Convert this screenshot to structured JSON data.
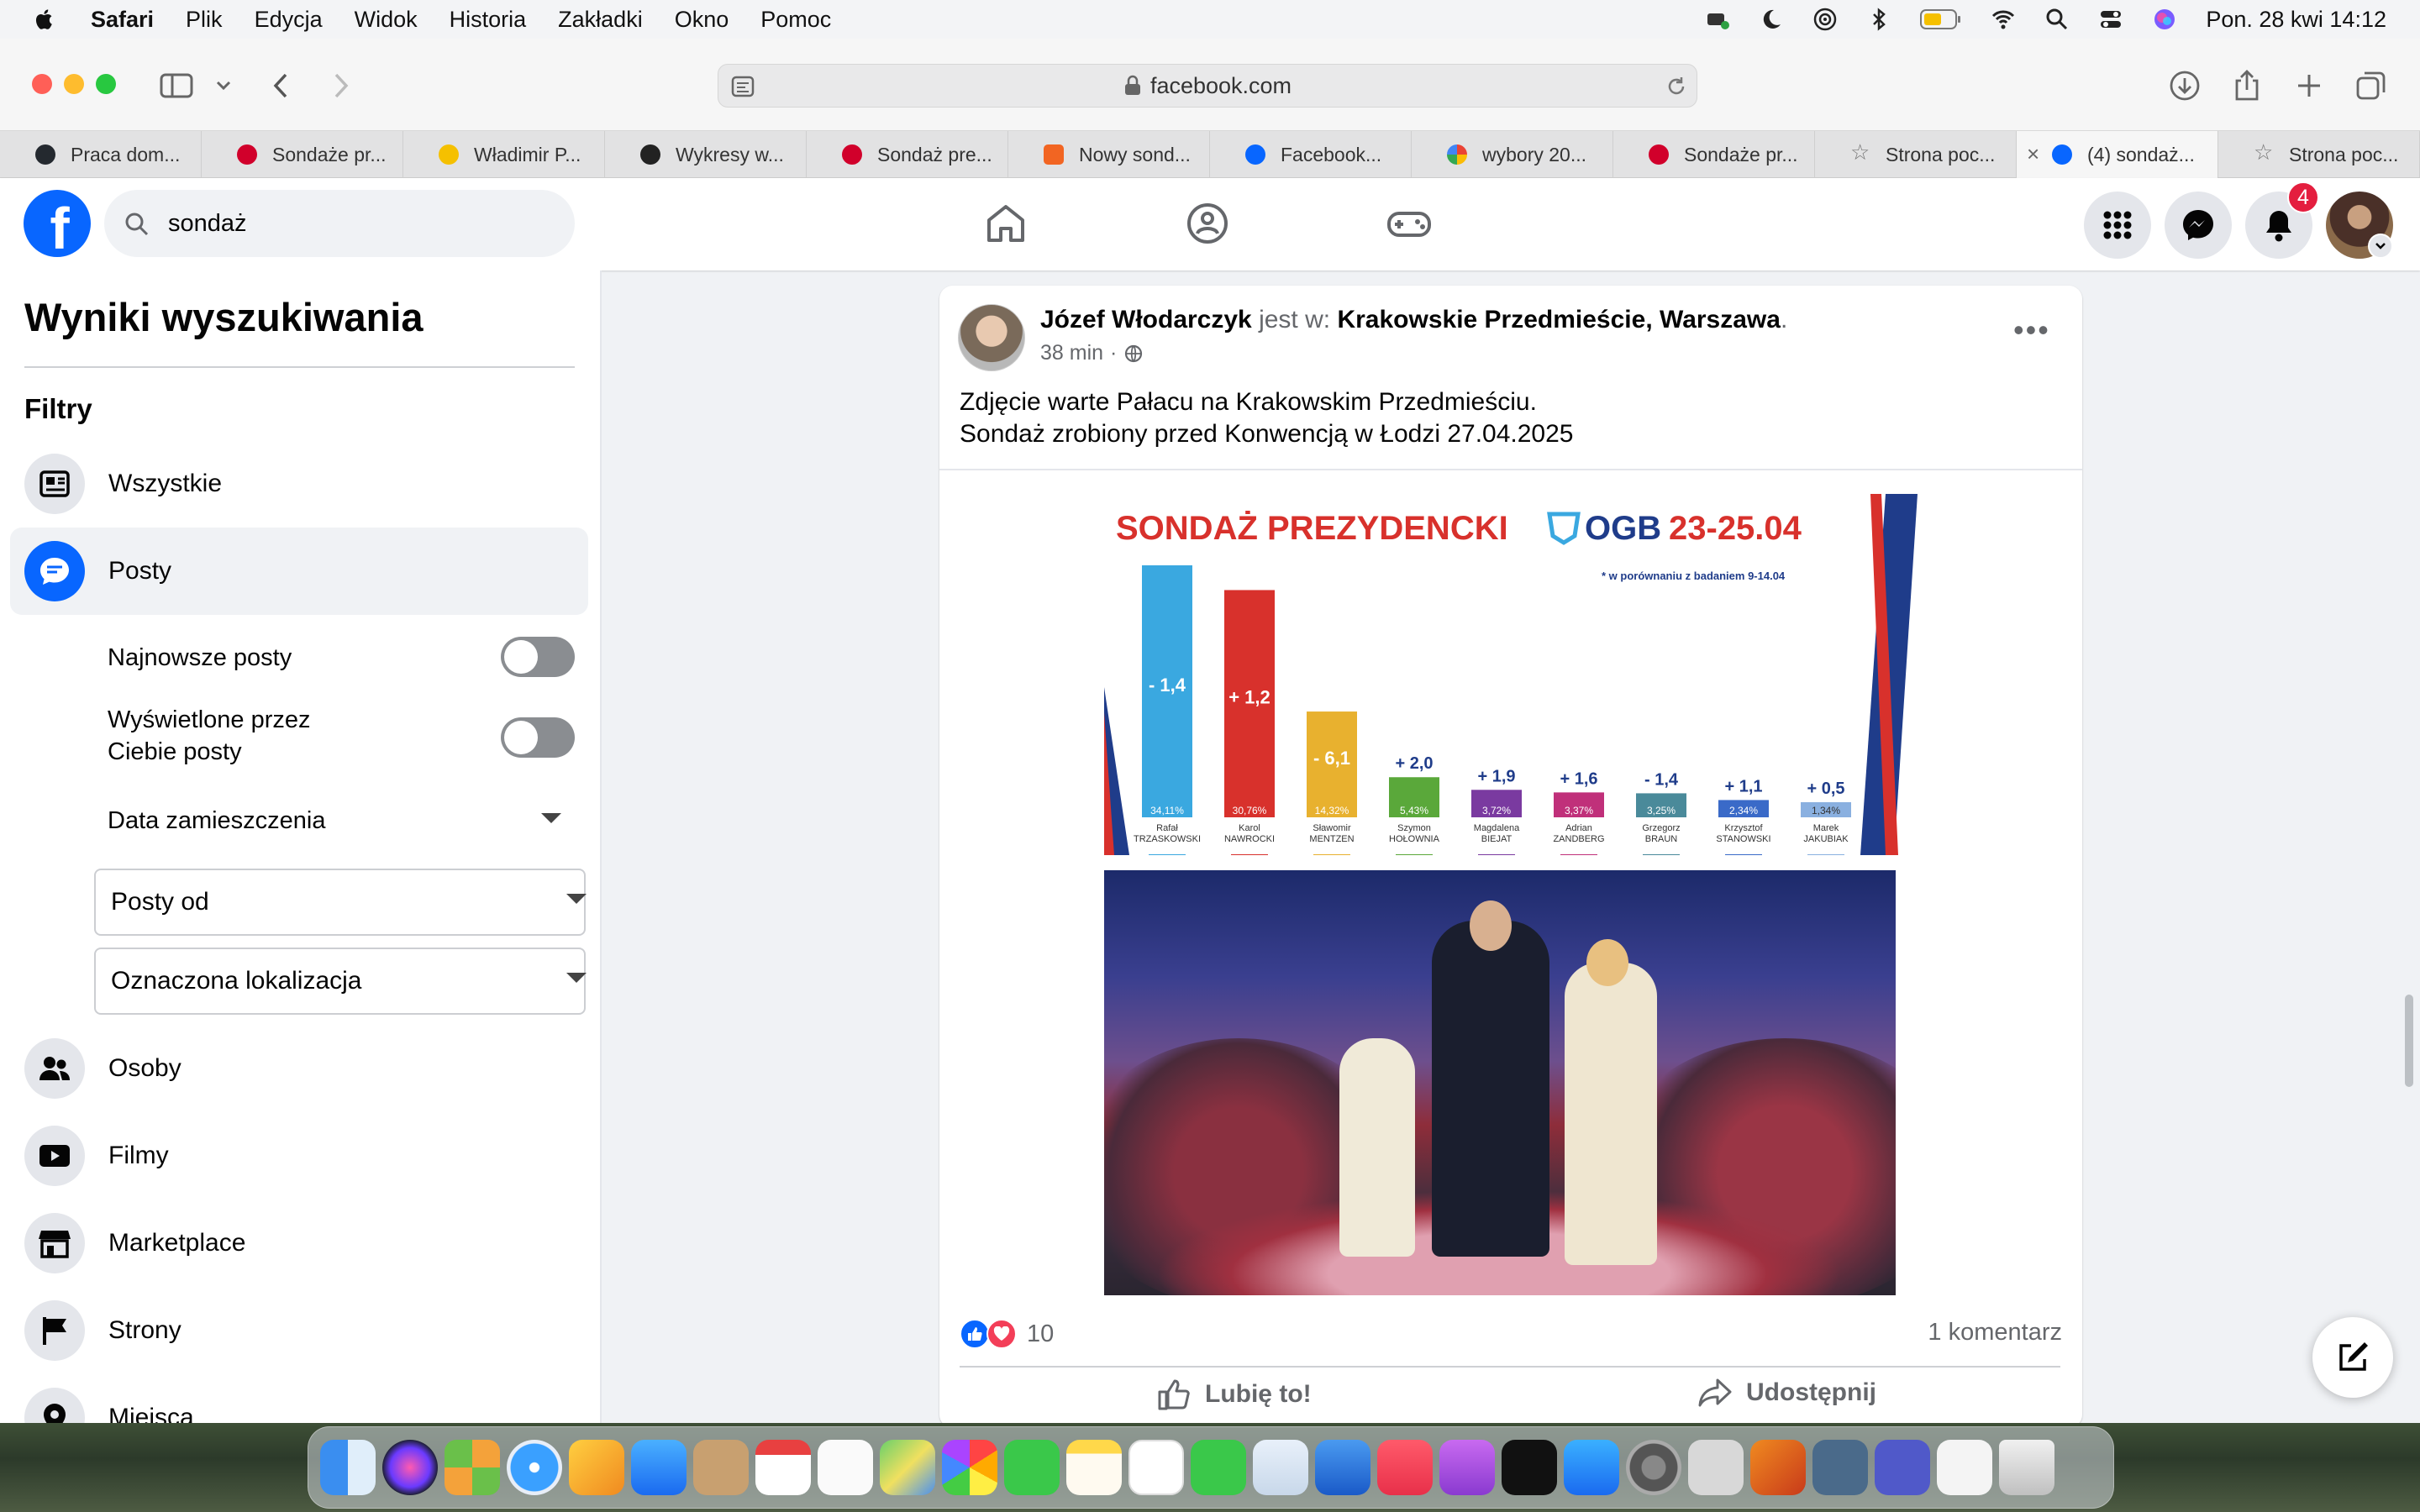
{
  "menubar": {
    "app": "Safari",
    "items": [
      "Plik",
      "Edycja",
      "Widok",
      "Historia",
      "Zakładki",
      "Okno",
      "Pomoc"
    ],
    "datetime": "Pon. 28 kwi  14:12"
  },
  "browser": {
    "url": "facebook.com",
    "tabs": [
      {
        "label": "Praca dom...",
        "color": "#24292f"
      },
      {
        "label": "Sondaże pr...",
        "color": "#d1002b"
      },
      {
        "label": "Władimir P...",
        "color": "#f5c000"
      },
      {
        "label": "Wykresy w...",
        "color": "#222222"
      },
      {
        "label": "Sondaż pre...",
        "color": "#d1002b"
      },
      {
        "label": "Nowy sond...",
        "color": "#f26522"
      },
      {
        "label": "Facebook...",
        "color": "#0866ff"
      },
      {
        "label": "wybory 20...",
        "color": "#4285f4"
      },
      {
        "label": "Sondaże pr...",
        "color": "#d1002b"
      },
      {
        "label": "Strona poc...",
        "color": "#888888"
      },
      {
        "label": "(4) sondaż...",
        "color": "#0866ff"
      },
      {
        "label": "Strona poc...",
        "color": "#888888"
      }
    ]
  },
  "facebook": {
    "search_value": "sondaż",
    "notifications_count": "4",
    "accent": "#0866ff"
  },
  "sidebar": {
    "title": "Wyniki wyszukiwania",
    "filters_label": "Filtry",
    "items": {
      "all": "Wszystkie",
      "posts": "Posty",
      "people": "Osoby",
      "videos": "Filmy",
      "marketplace": "Marketplace",
      "pages": "Strony",
      "places": "Miejsca"
    },
    "post_filters": {
      "recent": "Najnowsze posty",
      "seen_by_you": "Wyświetlone przez Ciebie posty",
      "date_posted": "Data zamieszczenia",
      "posts_from": "Posty od",
      "tagged_location": "Oznaczona lokalizacja"
    }
  },
  "post": {
    "author": "Józef Włodarczyk",
    "is_at": "jest w:",
    "location": "Krakowskie Przedmieście, Warszawa",
    "time": "38 min",
    "text_line1": "Zdjęcie warte Pałacu na Krakowskim Przedmieściu.",
    "text_line2": "Sondaż zrobiony przed Konwencją w Łodzi 27.04.2025",
    "reactions_count": "10",
    "comments": "1 komentarz",
    "like_label": "Lubię to!",
    "share_label": "Udostępnij"
  },
  "chart_data": {
    "type": "bar",
    "title": "SONDAŻ PREZYDENCKI",
    "brand": "OGB",
    "dates": "23-25.04",
    "note": "* w porównaniu z badaniem 9-14.04",
    "categories": [
      "Rafał TRZASKOWSKI",
      "Karol NAWROCKI",
      "Sławomir MENTZEN",
      "Szymon HOŁOWNIA",
      "Magdalena BIEJAT",
      "Adrian ZANDBERG",
      "Grzegorz BRAUN",
      "Krzysztof STANOWSKI",
      "Marek JAKUBIAK"
    ],
    "values": [
      34.11,
      30.76,
      14.32,
      5.43,
      3.72,
      3.37,
      3.25,
      2.34,
      1.34
    ],
    "value_labels": [
      "34,11%",
      "30,76%",
      "14,32%",
      "5,43%",
      "3,72%",
      "3,37%",
      "3,25%",
      "2,34%",
      "1,34%"
    ],
    "changes": [
      "- 1,4",
      "+ 1,2",
      "- 6,1",
      "+ 2,0",
      "+ 1,9",
      "+ 1,6",
      "- 1,4",
      "+ 1,1",
      "+ 0,5"
    ],
    "colors": [
      "#3aa8e0",
      "#d8312c",
      "#e8b12f",
      "#5aa83a",
      "#7a3aa0",
      "#c0307a",
      "#4a8a9a",
      "#3a6ac8",
      "#8ab0e0"
    ],
    "ylim": [
      0,
      34.11
    ]
  }
}
